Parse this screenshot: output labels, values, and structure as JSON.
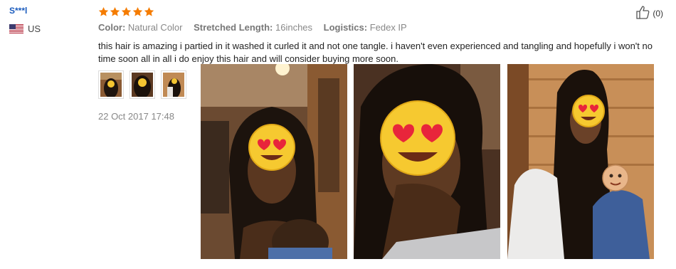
{
  "review": {
    "reviewer_name": "S***l",
    "country": "US",
    "flag_icon": "us-flag-icon",
    "rating": 5,
    "star_color": "#f57c00",
    "helpful_count": "(0)",
    "attributes": [
      {
        "key": "Color:",
        "value": "Natural Color"
      },
      {
        "key": "Stretched Length:",
        "value": "16inches"
      },
      {
        "key": "Logistics:",
        "value": "Fedex IP"
      }
    ],
    "text": "this hair is amazing i partied in it washed it curled it and not one tangle. i haven't even experienced and tangling and hopefully i won't no time soon all in all i do enjoy this hair and will consider buying more soon.",
    "date": "22 Oct 2017 17:48",
    "thumbnail_count": 3,
    "photo_count": 3
  }
}
